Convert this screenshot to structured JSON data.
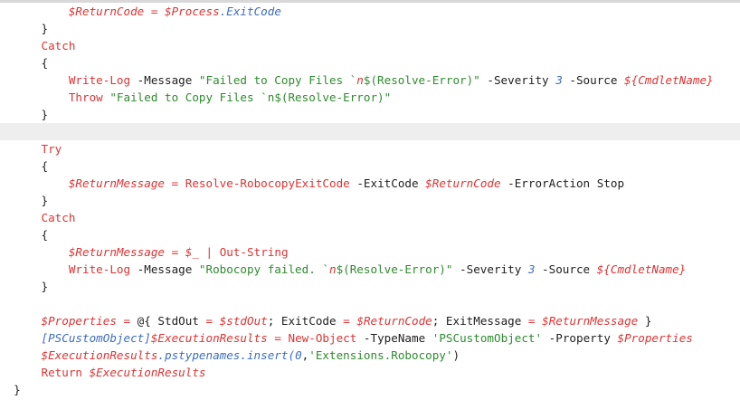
{
  "colors": {
    "keyword": "#dd3333",
    "variable": "#dd3333",
    "property": "#3e6dbf",
    "string": "#2e8b2e",
    "number": "#3e6dbf",
    "type": "#3e6dbf",
    "text": "#1e1e1e",
    "background": "#ffffff",
    "current_line": "#eeeeee"
  },
  "code_lines": [
    {
      "indent": "          ",
      "tokens": [
        [
          "var",
          "$ReturnCode"
        ],
        [
          "punct",
          " "
        ],
        [
          "op",
          "="
        ],
        [
          "punct",
          " "
        ],
        [
          "var",
          "$Process"
        ],
        [
          "prop",
          ".ExitCode"
        ]
      ]
    },
    {
      "indent": "      ",
      "tokens": [
        [
          "punct",
          "}"
        ]
      ]
    },
    {
      "indent": "      ",
      "tokens": [
        [
          "kw",
          "Catch"
        ]
      ]
    },
    {
      "indent": "      ",
      "tokens": [
        [
          "punct",
          "{"
        ]
      ]
    },
    {
      "indent": "          ",
      "tokens": [
        [
          "cmd",
          "Write-Log"
        ],
        [
          "param",
          " -Message "
        ],
        [
          "str",
          "\"Failed to Copy Files `"
        ],
        [
          "esc",
          "n"
        ],
        [
          "str",
          "$(Resolve-Error)\""
        ],
        [
          "param",
          " -Severity "
        ],
        [
          "num",
          "3"
        ],
        [
          "param",
          " -Source "
        ],
        [
          "var",
          "${CmdletName}"
        ]
      ]
    },
    {
      "indent": "          ",
      "tokens": [
        [
          "kw",
          "Throw"
        ],
        [
          "punct",
          " "
        ],
        [
          "str",
          "\"Failed to Copy Files `n$(Resolve-Error)\""
        ]
      ]
    },
    {
      "indent": "      ",
      "tokens": [
        [
          "punct",
          "}"
        ]
      ]
    },
    {
      "indent": "",
      "tokens": [],
      "highlight": true
    },
    {
      "indent": "      ",
      "tokens": [
        [
          "kw",
          "Try"
        ]
      ]
    },
    {
      "indent": "      ",
      "tokens": [
        [
          "punct",
          "{"
        ]
      ]
    },
    {
      "indent": "          ",
      "tokens": [
        [
          "var",
          "$ReturnMessage"
        ],
        [
          "punct",
          " "
        ],
        [
          "op",
          "="
        ],
        [
          "punct",
          " "
        ],
        [
          "cmd",
          "Resolve-RobocopyExitCode"
        ],
        [
          "param",
          " -ExitCode "
        ],
        [
          "var",
          "$ReturnCode"
        ],
        [
          "param",
          " -ErrorAction Stop"
        ]
      ]
    },
    {
      "indent": "      ",
      "tokens": [
        [
          "punct",
          "}"
        ]
      ]
    },
    {
      "indent": "      ",
      "tokens": [
        [
          "kw",
          "Catch"
        ]
      ]
    },
    {
      "indent": "      ",
      "tokens": [
        [
          "punct",
          "{"
        ]
      ]
    },
    {
      "indent": "          ",
      "tokens": [
        [
          "var",
          "$ReturnMessage"
        ],
        [
          "punct",
          " "
        ],
        [
          "op",
          "="
        ],
        [
          "punct",
          " "
        ],
        [
          "var",
          "$_"
        ],
        [
          "punct",
          " "
        ],
        [
          "op",
          "|"
        ],
        [
          "punct",
          " "
        ],
        [
          "cmd",
          "Out-String"
        ]
      ]
    },
    {
      "indent": "          ",
      "tokens": [
        [
          "cmd",
          "Write-Log"
        ],
        [
          "param",
          " -Message "
        ],
        [
          "str",
          "\"Robocopy failed. `"
        ],
        [
          "esc",
          "n"
        ],
        [
          "str",
          "$(Resolve-Error)\""
        ],
        [
          "param",
          " -Severity "
        ],
        [
          "num",
          "3"
        ],
        [
          "param",
          " -Source "
        ],
        [
          "var",
          "${CmdletName}"
        ]
      ]
    },
    {
      "indent": "      ",
      "tokens": [
        [
          "punct",
          "}"
        ]
      ]
    },
    {
      "indent": "",
      "tokens": []
    },
    {
      "indent": "      ",
      "tokens": [
        [
          "var",
          "$Properties"
        ],
        [
          "punct",
          " "
        ],
        [
          "op",
          "="
        ],
        [
          "punct",
          " @{ StdOut "
        ],
        [
          "op",
          "="
        ],
        [
          "punct",
          " "
        ],
        [
          "var",
          "$stdOut"
        ],
        [
          "punct",
          "; ExitCode "
        ],
        [
          "op",
          "="
        ],
        [
          "punct",
          " "
        ],
        [
          "var",
          "$ReturnCode"
        ],
        [
          "punct",
          "; ExitMessage "
        ],
        [
          "op",
          "="
        ],
        [
          "punct",
          " "
        ],
        [
          "var",
          "$ReturnMessage"
        ],
        [
          "punct",
          " }"
        ]
      ]
    },
    {
      "indent": "      ",
      "tokens": [
        [
          "type",
          "[PSCustomObject]"
        ],
        [
          "var",
          "$ExecutionResults"
        ],
        [
          "punct",
          " "
        ],
        [
          "op",
          "="
        ],
        [
          "punct",
          " "
        ],
        [
          "cmd",
          "New-Object"
        ],
        [
          "param",
          " -TypeName "
        ],
        [
          "str",
          "'PSCustomObject'"
        ],
        [
          "param",
          " -Property "
        ],
        [
          "var",
          "$Properties"
        ]
      ]
    },
    {
      "indent": "      ",
      "tokens": [
        [
          "var",
          "$ExecutionResults"
        ],
        [
          "prop",
          ".pstypenames.insert("
        ],
        [
          "num",
          "0"
        ],
        [
          "punct",
          ","
        ],
        [
          "str",
          "'Extensions.Robocopy'"
        ],
        [
          "punct",
          ")"
        ]
      ]
    },
    {
      "indent": "      ",
      "tokens": [
        [
          "kw",
          "Return"
        ],
        [
          "punct",
          " "
        ],
        [
          "var",
          "$ExecutionResults"
        ]
      ]
    },
    {
      "indent": "  ",
      "tokens": [
        [
          "punct",
          "}"
        ]
      ]
    }
  ]
}
